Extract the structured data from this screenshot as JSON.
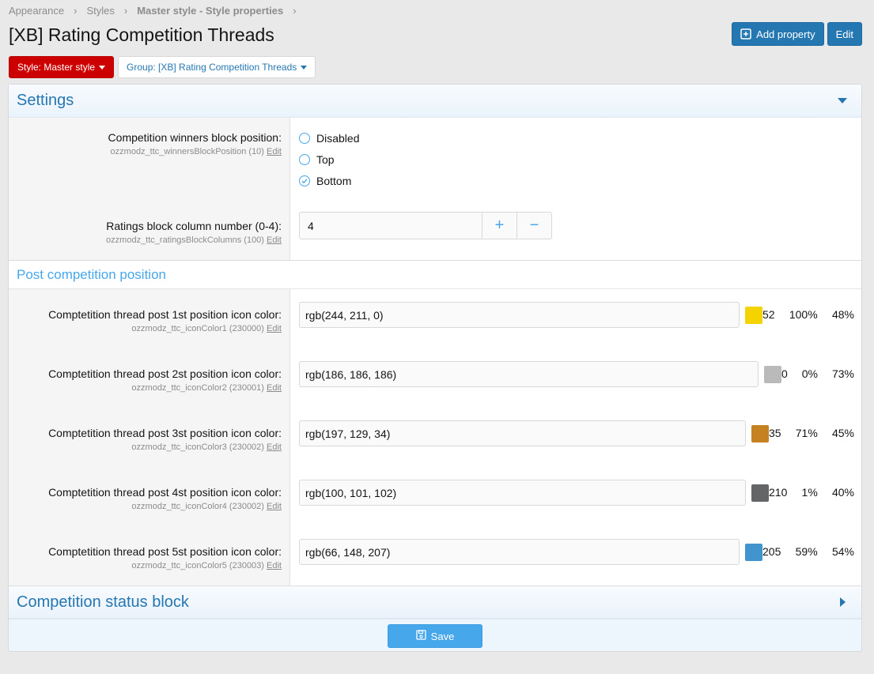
{
  "breadcrumb": [
    "Appearance",
    "Styles",
    "Master style - Style properties"
  ],
  "page_title": "[XB] Rating Competition Threads",
  "actions": {
    "add_property": "Add property",
    "edit": "Edit"
  },
  "filters": {
    "style": "Style: Master style",
    "group": "Group: [XB] Rating Competition Threads"
  },
  "sections": {
    "settings": "Settings",
    "post_position": "Post competition position",
    "status_block": "Competition status block"
  },
  "winners": {
    "label": "Competition winners block position:",
    "hint": "ozzmodz_ttc_winnersBlockPosition (10)",
    "edit": "Edit",
    "options": [
      "Disabled",
      "Top",
      "Bottom"
    ],
    "selected": "Bottom"
  },
  "ratings_columns": {
    "label": "Ratings block column number (0-4):",
    "hint": "ozzmodz_ttc_ratingsBlockColumns (100)",
    "edit": "Edit",
    "value": "4",
    "plus": "+",
    "minus": "−"
  },
  "icon_colors": [
    {
      "label": "Comptetition thread post 1st position icon color:",
      "hint": "ozzmodz_ttc_iconColor1 (230000)",
      "edit": "Edit",
      "value": "rgb(244, 211, 0)",
      "swatch": "#f4d300",
      "h": "52",
      "s": "100%",
      "l": "48%"
    },
    {
      "label": "Comptetition thread post 2st position icon color:",
      "hint": "ozzmodz_ttc_iconColor2 (230001)",
      "edit": "Edit",
      "value": "rgb(186, 186, 186)",
      "swatch": "#bababa",
      "h": "0",
      "s": "0%",
      "l": "73%"
    },
    {
      "label": "Comptetition thread post 3st position icon color:",
      "hint": "ozzmodz_ttc_iconColor3 (230002)",
      "edit": "Edit",
      "value": "rgb(197, 129, 34)",
      "swatch": "#c58122",
      "h": "35",
      "s": "71%",
      "l": "45%"
    },
    {
      "label": "Comptetition thread post 4st position icon color:",
      "hint": "ozzmodz_ttc_iconColor4 (230002)",
      "edit": "Edit",
      "value": "rgb(100, 101, 102)",
      "swatch": "#646566",
      "h": "210",
      "s": "1%",
      "l": "40%"
    },
    {
      "label": "Comptetition thread post 5st position icon color:",
      "hint": "ozzmodz_ttc_iconColor5 (230003)",
      "edit": "Edit",
      "value": "rgb(66, 148, 207)",
      "swatch": "#4294cf",
      "h": "205",
      "s": "59%",
      "l": "54%"
    }
  ],
  "save": "Save",
  "colors": {
    "primary": "#2577b1",
    "accent": "#47a7eb",
    "style_button": "#cc0000"
  }
}
